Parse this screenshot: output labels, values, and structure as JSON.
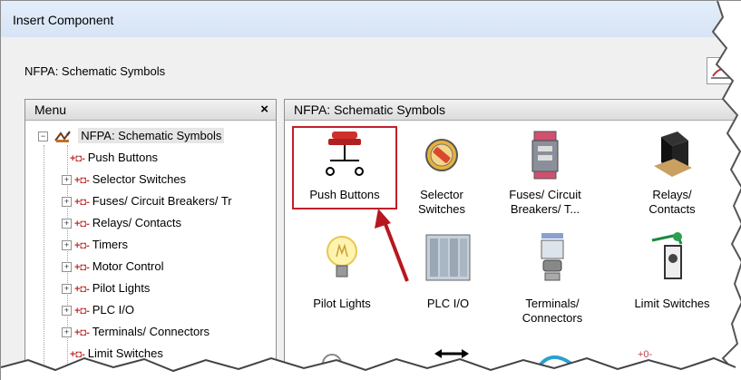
{
  "window": {
    "title": "Insert Component"
  },
  "library_label": "NFPA: Schematic Symbols",
  "menu": {
    "header": "Menu",
    "close_glyph": "×",
    "root": "NFPA: Schematic Symbols",
    "items": [
      {
        "label": "Push Buttons",
        "expandable": false
      },
      {
        "label": "Selector Switches",
        "expandable": true
      },
      {
        "label": "Fuses/ Circuit Breakers/ Tr",
        "expandable": true
      },
      {
        "label": "Relays/ Contacts",
        "expandable": true
      },
      {
        "label": "Timers",
        "expandable": true
      },
      {
        "label": "Motor Control",
        "expandable": true
      },
      {
        "label": "Pilot Lights",
        "expandable": true
      },
      {
        "label": "PLC I/O",
        "expandable": true
      },
      {
        "label": "Terminals/ Connectors",
        "expandable": true
      },
      {
        "label": "Limit Switches",
        "expandable": false
      }
    ]
  },
  "symbols_panel": {
    "header": "NFPA: Schematic Symbols",
    "items": [
      {
        "line1": "Push Buttons",
        "line2": "",
        "icon": "push-button-icon",
        "selected": true
      },
      {
        "line1": "Selector",
        "line2": "Switches",
        "icon": "selector-switch-icon"
      },
      {
        "line1": "Fuses/ Circuit",
        "line2": "Breakers/ T...",
        "icon": "fuse-breaker-icon"
      },
      {
        "line1": "Relays/",
        "line2": "Contacts",
        "icon": "relay-icon"
      },
      {
        "line1": "Pilot Lights",
        "line2": "",
        "icon": "pilot-light-icon"
      },
      {
        "line1": "PLC I/O",
        "line2": "",
        "icon": "plc-io-icon"
      },
      {
        "line1": "Terminals/",
        "line2": "Connectors",
        "icon": "terminal-icon"
      },
      {
        "line1": "Limit Switches",
        "line2": "",
        "icon": "limit-switch-icon"
      }
    ]
  },
  "colors": {
    "highlight": "#c0202a",
    "arrow": "#b8171f"
  }
}
